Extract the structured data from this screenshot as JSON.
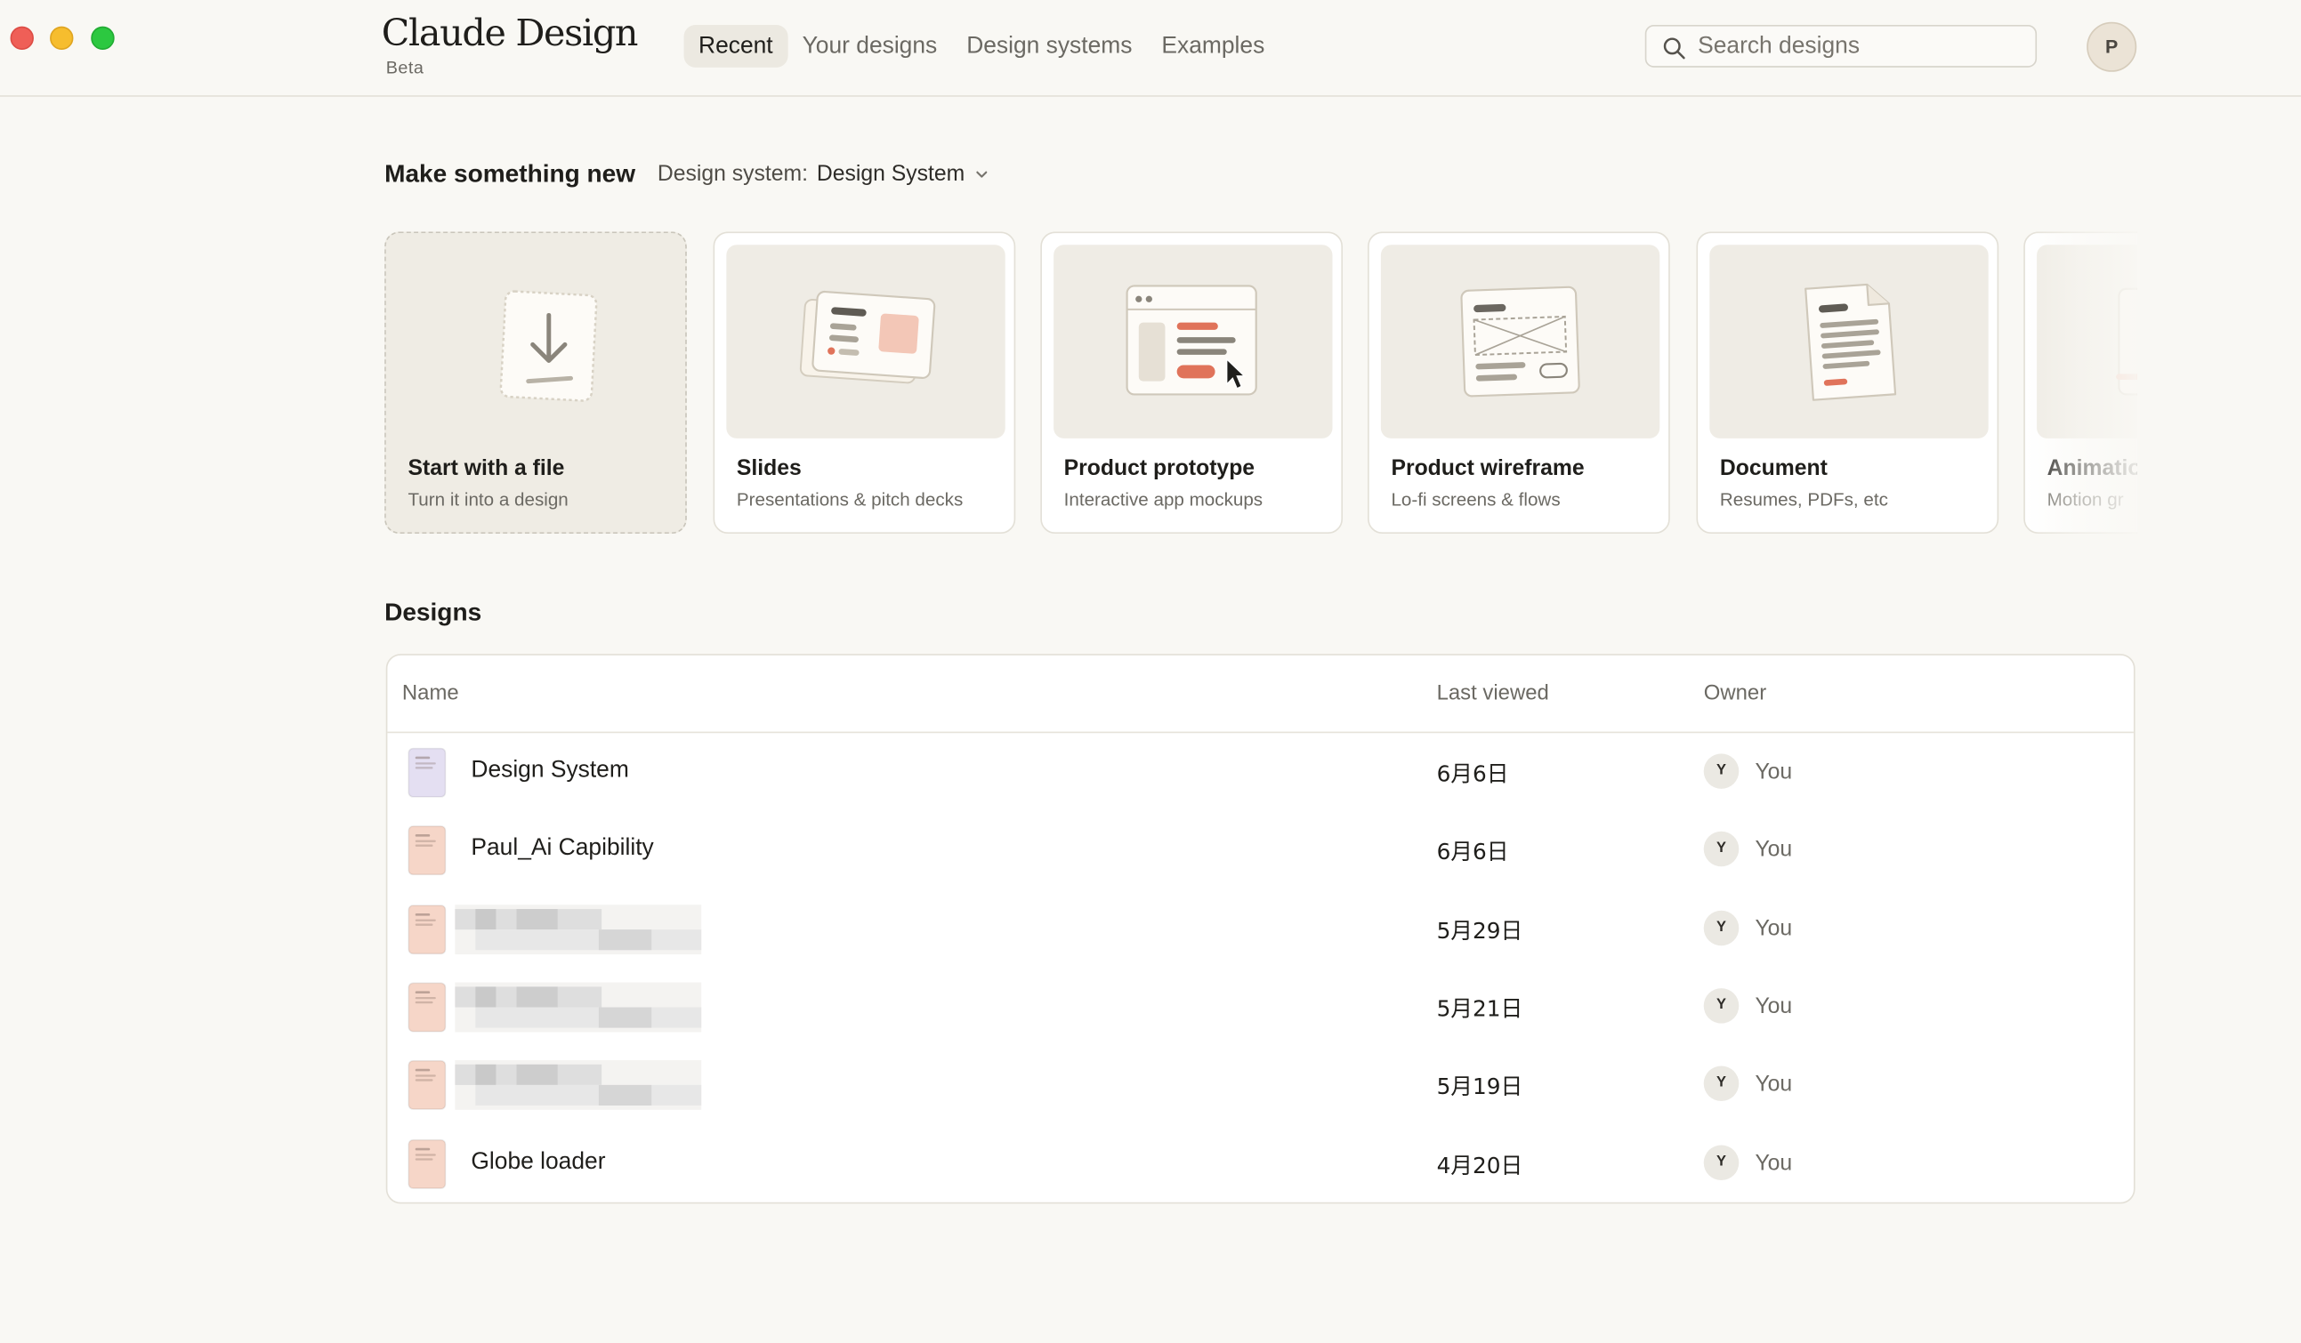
{
  "window": {
    "controls": [
      "close",
      "minimize",
      "zoom"
    ]
  },
  "header": {
    "logo": "Claude Design",
    "badge": "Beta",
    "tabs": [
      {
        "label": "Recent",
        "active": true
      },
      {
        "label": "Your designs",
        "active": false
      },
      {
        "label": "Design systems",
        "active": false
      },
      {
        "label": "Examples",
        "active": false
      }
    ],
    "search": {
      "placeholder": "Search designs",
      "value": "",
      "icon": "search-icon"
    },
    "avatar_initial": "P"
  },
  "create": {
    "title": "Make something new",
    "design_system_label": "Design system:",
    "design_system_value": "Design System",
    "cards": [
      {
        "title": "Start with a file",
        "subtitle": "Turn it into a design",
        "icon": "download-file-icon"
      },
      {
        "title": "Slides",
        "subtitle": "Presentations & pitch decks",
        "icon": "slides-illustration"
      },
      {
        "title": "Product prototype",
        "subtitle": "Interactive app mockups",
        "icon": "prototype-illustration"
      },
      {
        "title": "Product wireframe",
        "subtitle": "Lo-fi screens & flows",
        "icon": "wireframe-illustration"
      },
      {
        "title": "Document",
        "subtitle": "Resumes, PDFs, etc",
        "icon": "document-illustration"
      },
      {
        "title": "Animatio",
        "subtitle": "Motion gr",
        "icon": "animation-illustration"
      }
    ]
  },
  "designs": {
    "title": "Designs",
    "columns": {
      "name": "Name",
      "last_viewed": "Last viewed",
      "owner": "Owner"
    },
    "rows": [
      {
        "name": "Design System",
        "last_viewed": "6月6日",
        "owner_initial": "Y",
        "owner": "You",
        "icon_color": "#e4dff2",
        "redacted": false
      },
      {
        "name": "Paul_Ai Capibility",
        "last_viewed": "6月6日",
        "owner_initial": "Y",
        "owner": "You",
        "icon_color": "#f6d6c8",
        "redacted": false
      },
      {
        "name": "",
        "last_viewed": "5月29日",
        "owner_initial": "Y",
        "owner": "You",
        "icon_color": "#f6d6c8",
        "redacted": true
      },
      {
        "name": "",
        "last_viewed": "5月21日",
        "owner_initial": "Y",
        "owner": "You",
        "icon_color": "#f6d6c8",
        "redacted": true
      },
      {
        "name": "",
        "last_viewed": "5月19日",
        "owner_initial": "Y",
        "owner": "You",
        "icon_color": "#f6d6c8",
        "redacted": true
      },
      {
        "name": "Globe loader",
        "last_viewed": "4月20日",
        "owner_initial": "Y",
        "owner": "You",
        "icon_color": "#f6d6c8",
        "redacted": false
      }
    ]
  },
  "colors": {
    "background": "#f9f8f4",
    "accent": "#e0735a",
    "muted_text": "#6b6963",
    "border": "#e3e0d7"
  }
}
